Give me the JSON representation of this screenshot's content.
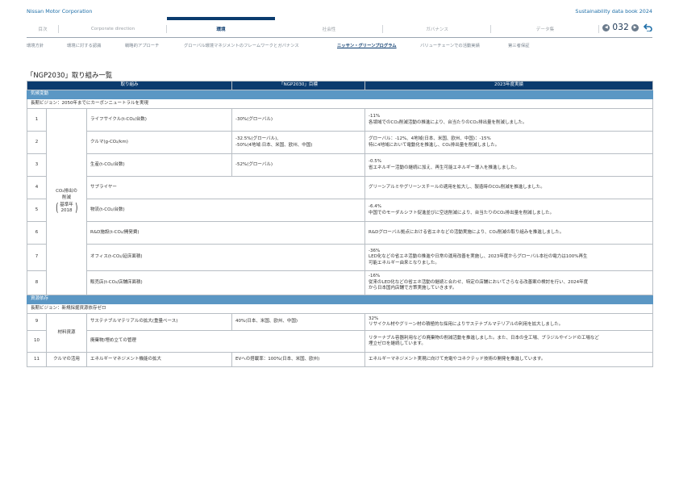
{
  "header": {
    "company": "Nissan Motor Corporation",
    "databook": "Sustainability data book 2024"
  },
  "nav": {
    "tabs": [
      "目次",
      "Corporate direction",
      "環境",
      "社会性",
      "ガバナンス",
      "データ集"
    ],
    "active_index": 2,
    "page_number": "032"
  },
  "subnav": {
    "items": [
      "環境方針",
      "環境に対する認識",
      "戦略的アプローチ",
      "グローバル環境マネジメントのフレームワークとガバナンス",
      "ニッサン・グリーンプログラム",
      "バリューチェーンでの活動実績",
      "第三者保証"
    ],
    "active_index": 4
  },
  "section_title": "「NGP2030」取り組み一覧",
  "table": {
    "headers": [
      "取り組み",
      "「NGP2030」目標",
      "2023年度実績"
    ],
    "categories": [
      {
        "name": "気候変動",
        "vision": "長期ビジョン：2050年までにカーボンニュートラルを実現",
        "group": {
          "line1": "CO₂排出の",
          "line2": "削減",
          "base_label": "基準年",
          "base_year": "2018"
        },
        "rows": [
          {
            "no": "1",
            "item": "ライフサイクル(t-CO₂/台数)",
            "target": [
              "-30%(グローバル)"
            ],
            "result": [
              "-11%",
              "各領域でのCO₂削減活動の推進により、台当たりのCO₂排出量を削減しました。"
            ]
          },
          {
            "no": "2",
            "item": "クルマ(g-CO₂/km)",
            "target": [
              "-32.5%(グローバル)、",
              "-50%(4地域:日本、米国、欧州、中国)"
            ],
            "result": [
              "グローバル：-12%、4地域(日本、米国、欧州、中国)：-15%",
              "特に4地域において電動化を推進し、CO₂排出量を削減しました。"
            ]
          },
          {
            "no": "3",
            "item": "生産(t-CO₂/台数)",
            "target": [
              "-52%(グローバル)"
            ],
            "result": [
              "-0.5%",
              "省エネルギー活動の継続に加え、再生可能エネルギー導入を推進しました。"
            ]
          },
          {
            "no": "4",
            "item": "サプライヤー",
            "target": [],
            "result": [
              "グリーンアルミやグリーンスチールの適用を拡大し、製造時のCO₂削減を推進しました。"
            ]
          },
          {
            "no": "5",
            "item": "物流(t-CO₂/台数)",
            "target": [],
            "result": [
              "-6.4%",
              "中国でのモーダルシフト促進並びに空送削減により、台当たりのCO₂排出量を削減しました。"
            ]
          },
          {
            "no": "6",
            "item": "R&D施設(t-CO₂/開発費)",
            "target": [],
            "result": [
              "R&Dグローバル拠点における省エネなどの活動実施により、CO₂削減の取り組みを推進しました。"
            ]
          },
          {
            "no": "7",
            "item": "オフィス(t-CO₂/延床面積)",
            "target": [],
            "result": [
              "-36%",
              "LED化などの省エネ活動の推進や日常の運用改善を実施し、2023年度からグローバル本社の電力は100%再生",
              "可能エネルギー由来となりました。"
            ]
          },
          {
            "no": "8",
            "item": "販売店(t-CO₂/店舗床面積)",
            "target": [],
            "result": [
              "-16%",
              "従来のLED化などの省エネ活動の継続と合わせ、特定の店舗においてさらなる改善案の検討を行い、2024年度",
              "から日本国内店舗で方策実施していきます。"
            ]
          }
        ]
      },
      {
        "name": "資源依存",
        "vision": "長期ビジョン：新規採掘資源依存ゼロ",
        "group": {
          "line1": "材料資源"
        },
        "rows": [
          {
            "no": "9",
            "item": "サステナブルマテリアルの拡大(重量ベース)",
            "target": [
              "40%(日本、米国、欧州、中国)"
            ],
            "result": [
              "32%",
              "リサイクル材やグリーン材の積極的な採用によりサステナブルマテリアルの利用を拡大しました。"
            ]
          },
          {
            "no": "10",
            "item": "廃棄物/埋め立ての管理",
            "target": [],
            "result": [
              "リターナブル容器利用などの廃棄物の削減活動を推進しました。また、日本の全工場、ブラジルやインドの工場など",
              "埋立ゼロを継続しています。"
            ]
          }
        ]
      },
      {
        "rows": [
          {
            "no": "11",
            "group": "クルマの活用",
            "item": "エネルギーマネジメント機能の拡大",
            "target": [
              "EVへの搭載率：100%(日本、米国、欧州)"
            ],
            "result": [
              "エネルギーマネジメント実現に向けて充電やコネクテッド技術の開発を推進しています。"
            ]
          }
        ]
      }
    ]
  }
}
